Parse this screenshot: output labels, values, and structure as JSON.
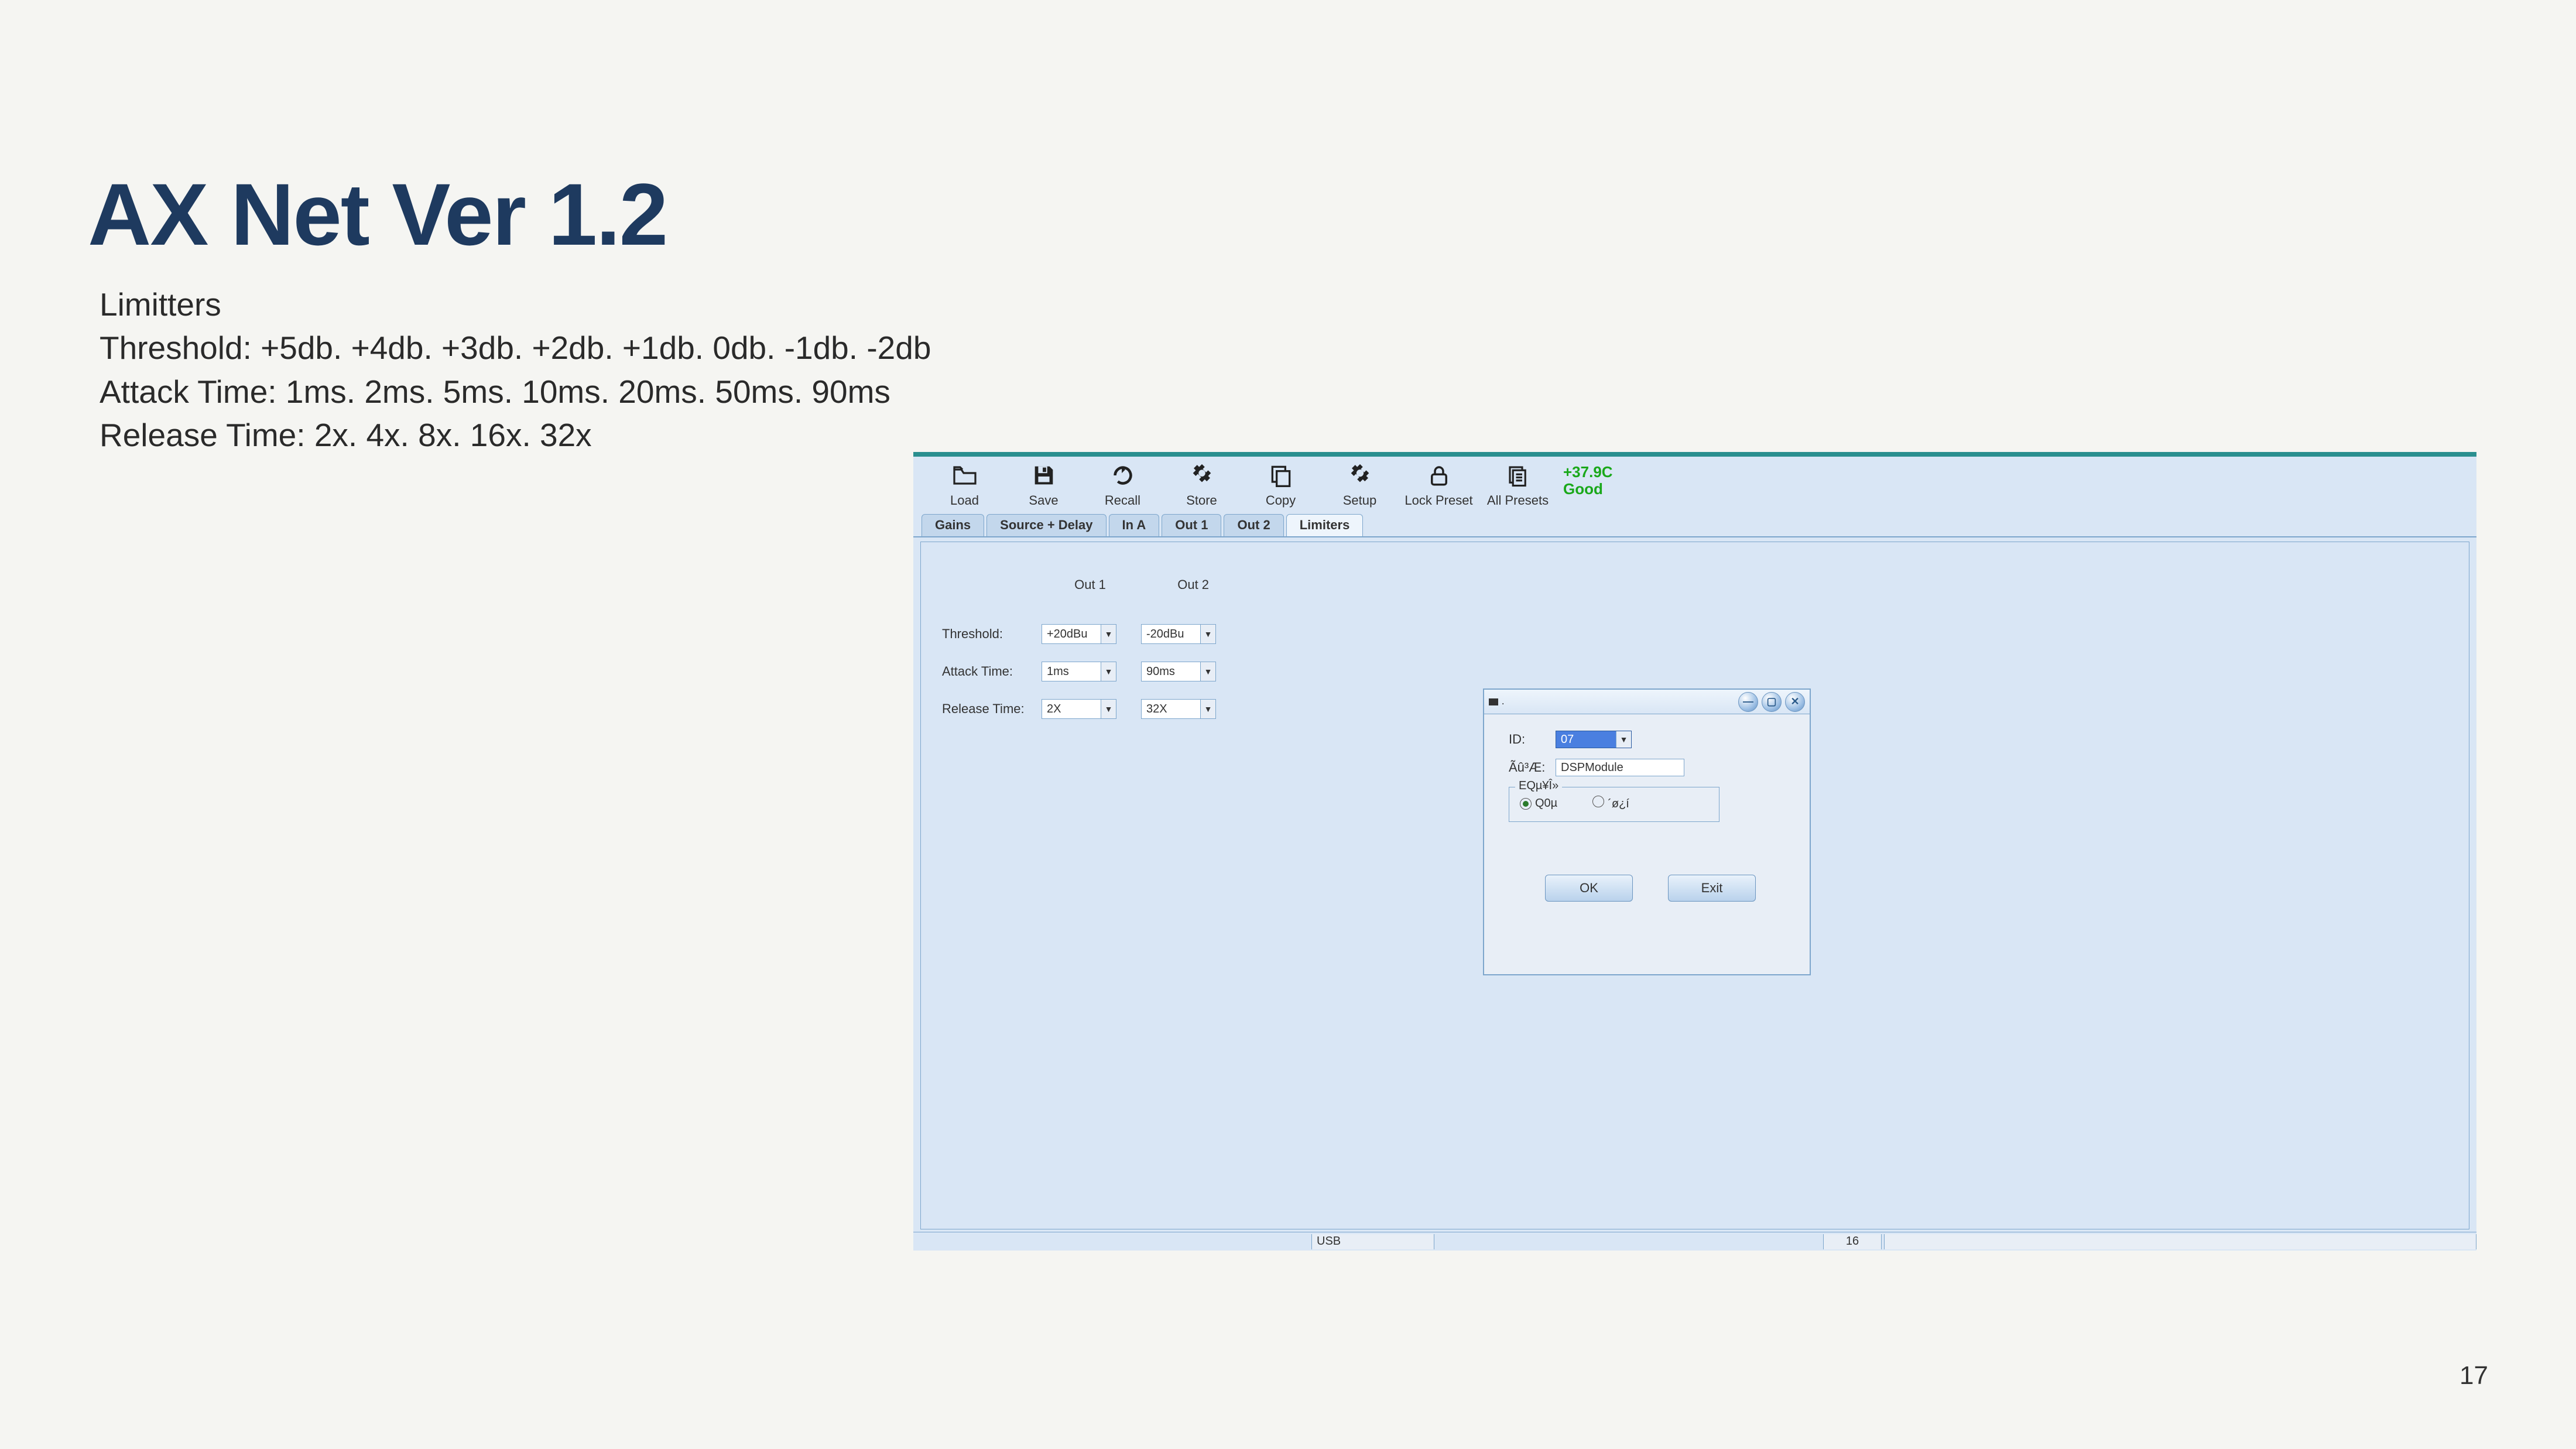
{
  "slide": {
    "title": "AX Net Ver 1.2",
    "line1": "Limitters",
    "line2": "Threshold: +5db. +4db. +3db. +2db. +1db. 0db. -1db. -2db",
    "line3": "Attack Time: 1ms. 2ms. 5ms. 10ms. 20ms. 50ms. 90ms",
    "line4": "Release Time: 2x. 4x. 8x. 16x. 32x",
    "page_number": "17"
  },
  "toolbar": {
    "load": "Load",
    "save": "Save",
    "recall": "Recall",
    "store": "Store",
    "copy": "Copy",
    "setup": "Setup",
    "lock": "Lock Preset",
    "all": "All Presets"
  },
  "status": {
    "temp": "+37.9C",
    "text": "Good"
  },
  "tabs": {
    "gains": "Gains",
    "source_delay": "Source + Delay",
    "in_a": "In A",
    "out1": "Out 1",
    "out2": "Out 2",
    "limiters": "Limiters"
  },
  "panel": {
    "col1": "Out 1",
    "col2": "Out 2",
    "threshold_label": "Threshold:",
    "attack_label": "Attack Time:",
    "release_label": "Release Time:",
    "threshold": {
      "out1": "+20dBu",
      "out2": "-20dBu"
    },
    "attack": {
      "out1": "1ms",
      "out2": "90ms"
    },
    "release": {
      "out1": "2X",
      "out2": "32X"
    }
  },
  "dialog": {
    "titlebit": ".",
    "id_label": "ID:",
    "id_value": "07",
    "name_label": "Ãû³Æ:",
    "name_value": "DSPModule",
    "group_label": "EQµ¥Î»",
    "radio1": "Q0µ",
    "radio2": "´ø¿í",
    "ok": "OK",
    "exit": "Exit"
  },
  "statusbar": {
    "conn": "USB",
    "val": "16"
  }
}
